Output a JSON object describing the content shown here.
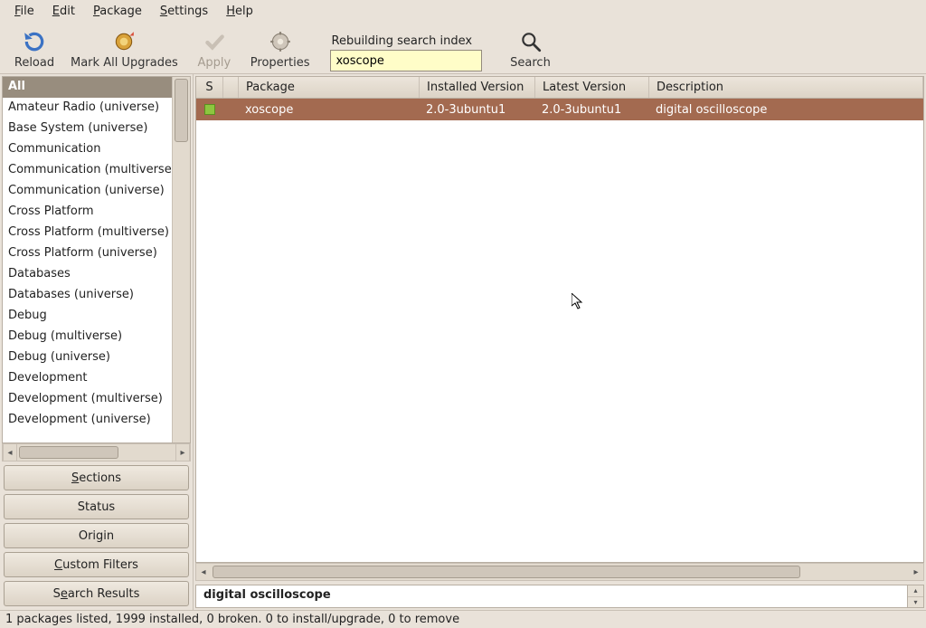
{
  "menu": {
    "file": {
      "label": "File",
      "underline": 0
    },
    "edit": {
      "label": "Edit",
      "underline": 0
    },
    "package": {
      "label": "Package",
      "underline": 0
    },
    "settings": {
      "label": "Settings",
      "underline": 0
    },
    "help": {
      "label": "Help",
      "underline": 0
    }
  },
  "toolbar": {
    "reload": "Reload",
    "mark_all": "Mark All Upgrades",
    "apply": "Apply",
    "properties": "Properties",
    "search": "Search"
  },
  "search_block": {
    "caption": "Rebuilding search index",
    "value": "xoscope"
  },
  "sections": {
    "selected_index": 0,
    "items": [
      "All",
      "Amateur Radio (universe)",
      "Base System (universe)",
      "Communication",
      "Communication (multiverse)",
      "Communication (universe)",
      "Cross Platform",
      "Cross Platform (multiverse)",
      "Cross Platform (universe)",
      "Databases",
      "Databases (universe)",
      "Debug",
      "Debug (multiverse)",
      "Debug (universe)",
      "Development",
      "Development (multiverse)",
      "Development (universe)"
    ]
  },
  "filter_buttons": {
    "sections": "Sections",
    "status": "Status",
    "origin": "Origin",
    "custom": "Custom Filters",
    "search_results": "Search Results"
  },
  "table": {
    "headers": {
      "s": "S",
      "package": "Package",
      "installed": "Installed Version",
      "latest": "Latest Version",
      "description": "Description"
    },
    "rows": [
      {
        "package": "xoscope",
        "installed": "2.0-3ubuntu1",
        "latest": "2.0-3ubuntu1",
        "description": "digital oscilloscope",
        "status": "installed"
      }
    ]
  },
  "description_panel": "digital oscilloscope",
  "statusbar": "1 packages listed, 1999 installed, 0 broken. 0 to install/upgrade, 0 to remove"
}
